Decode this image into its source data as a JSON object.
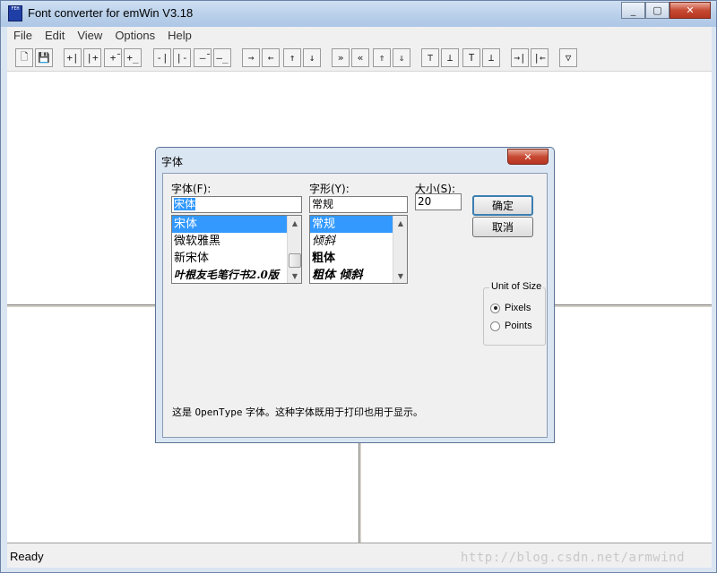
{
  "window": {
    "title": "Font converter for emWin V3.18",
    "icon_text": "FEH"
  },
  "caption": {
    "minimize": "_",
    "maximize": "▢",
    "close": "✕"
  },
  "menu": [
    "File",
    "Edit",
    "View",
    "Options",
    "Help"
  ],
  "toolbar": [
    {
      "name": "new-icon",
      "glyph": "🗋"
    },
    {
      "name": "save-icon",
      "glyph": "💾"
    },
    {
      "name": "insert-left-icon",
      "glyph": "+|"
    },
    {
      "name": "insert-right-icon",
      "glyph": "|+"
    },
    {
      "name": "insert-top-icon",
      "glyph": "+̄"
    },
    {
      "name": "insert-bottom-icon",
      "glyph": "+̲"
    },
    {
      "name": "delete-left-icon",
      "glyph": "-|"
    },
    {
      "name": "delete-right-icon",
      "glyph": "|-"
    },
    {
      "name": "delete-top-icon",
      "glyph": "–̄"
    },
    {
      "name": "delete-bottom-icon",
      "glyph": "–̲"
    },
    {
      "name": "shift-right-icon",
      "glyph": "→"
    },
    {
      "name": "shift-left-icon",
      "glyph": "←"
    },
    {
      "name": "shift-up-icon",
      "glyph": "↑"
    },
    {
      "name": "shift-down-icon",
      "glyph": "↓"
    },
    {
      "name": "all-right-icon",
      "glyph": "»"
    },
    {
      "name": "all-left-icon",
      "glyph": "«"
    },
    {
      "name": "all-up-icon",
      "glyph": "⇑"
    },
    {
      "name": "all-down-icon",
      "glyph": "⇓"
    },
    {
      "name": "align-top-icon",
      "glyph": "⊤"
    },
    {
      "name": "align-bottom-icon",
      "glyph": "⊥"
    },
    {
      "name": "align-top-2-icon",
      "glyph": "T"
    },
    {
      "name": "align-bottom-2-icon",
      "glyph": "⊥"
    },
    {
      "name": "move-right-edge-icon",
      "glyph": "→|"
    },
    {
      "name": "move-left-edge-icon",
      "glyph": "|←"
    },
    {
      "name": "filter-icon",
      "glyph": "▽"
    }
  ],
  "status": "Ready",
  "watermark": "http://blog.csdn.net/armwind",
  "dialog": {
    "title": "字体",
    "close_label": "✕",
    "font_label": "字体(F):",
    "font_value": "宋体",
    "font_list": [
      "宋体",
      "微软雅黑",
      "新宋体",
      "叶根友毛笔行书2.0版"
    ],
    "style_label": "字形(Y):",
    "style_value": "常规",
    "style_list": [
      "常规",
      "倾斜",
      "粗体",
      "粗体 倾斜"
    ],
    "size_label": "大小(S):",
    "size_value": "20",
    "ok_label": "确定",
    "cancel_label": "取消",
    "unit_group_label": "Unit of Size",
    "unit_pixels": "Pixels",
    "unit_points": "Points",
    "unit_selected": "Pixels",
    "desc_prefix": "这是",
    "desc_mono": "OpenType",
    "desc_suffix": "字体。这种字体既用于打印也用于显示。"
  }
}
